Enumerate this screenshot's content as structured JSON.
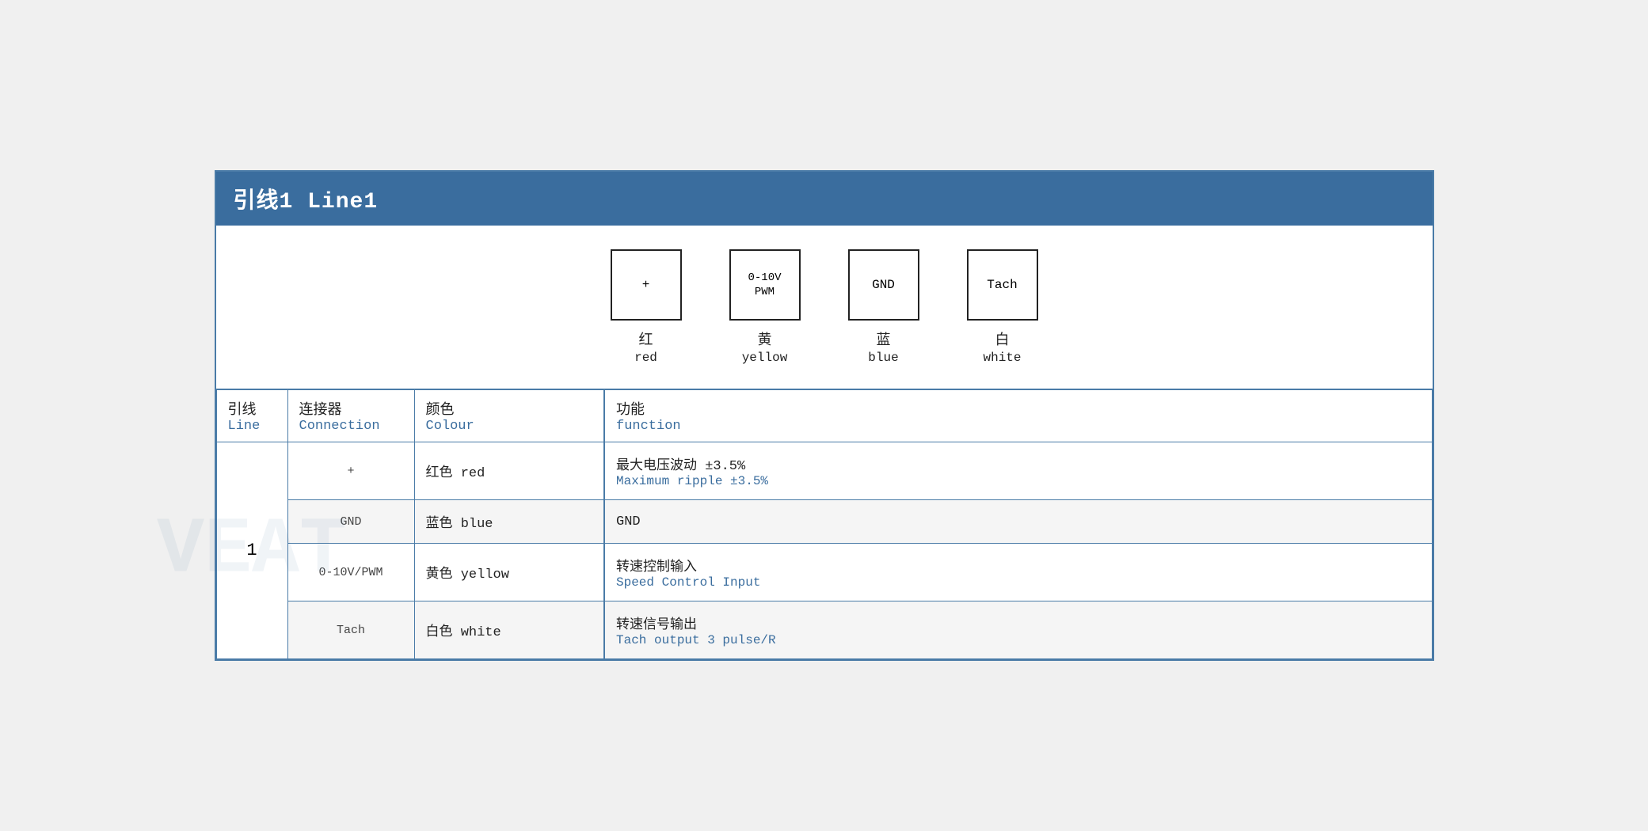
{
  "title": "引线1 Line1",
  "terminals": [
    {
      "symbol": "+",
      "zh": "红",
      "en": "red"
    },
    {
      "symbol": "0-10V\nPWM",
      "zh": "黄",
      "en": "yellow"
    },
    {
      "symbol": "GND",
      "zh": "蓝",
      "en": "blue"
    },
    {
      "symbol": "Tach",
      "zh": "白",
      "en": "white"
    }
  ],
  "header": {
    "line_zh": "引线",
    "line_en": "Line",
    "conn_zh": "连接器",
    "conn_en": "Connection",
    "colour_zh": "颜色",
    "colour_en": "Colour",
    "func_zh": "功能",
    "func_en": "function"
  },
  "rows": [
    {
      "line": "1",
      "rowspan": 4,
      "sub_rows": [
        {
          "conn": "+",
          "colour_zh": "红色 red",
          "func_zh": "最大电压波动 ±3.5%",
          "func_en": "Maximum ripple ±3.5%",
          "bg": "white"
        },
        {
          "conn": "GND",
          "colour_zh": "蓝色 blue",
          "func_zh": "GND",
          "func_en": "",
          "bg": "light"
        },
        {
          "conn": "0-10V/PWM",
          "colour_zh": "黄色 yellow",
          "func_zh": "转速控制输入",
          "func_en": "Speed Control Input",
          "bg": "white"
        },
        {
          "conn": "Tach",
          "colour_zh": "白色 white",
          "func_zh": "转速信号输出",
          "func_en": "Tach output 3 pulse/R",
          "bg": "light"
        }
      ]
    }
  ]
}
